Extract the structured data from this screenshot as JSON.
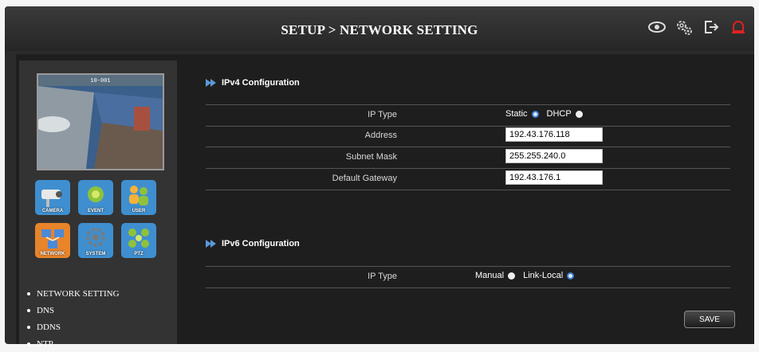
{
  "header": {
    "title": "SETUP > NETWORK SETTING",
    "icons": [
      "eye-icon",
      "settings-gear-icon",
      "logout-icon",
      "alarm-bell-icon"
    ],
    "alarm_color": "#e02020"
  },
  "sidebar": {
    "preview": {
      "timestamp": "10-001"
    },
    "modules": [
      {
        "label": "CAMERA",
        "icon": "camera-icon"
      },
      {
        "label": "EVENT",
        "icon": "event-icon"
      },
      {
        "label": "USER",
        "icon": "user-icon"
      },
      {
        "label": "NETWORK",
        "icon": "network-icon",
        "active": true
      },
      {
        "label": "SYSTEM",
        "icon": "system-icon"
      },
      {
        "label": "PTZ",
        "icon": "ptz-icon"
      }
    ],
    "nav_items": [
      "NETWORK SETTING",
      "DNS",
      "DDNS",
      "NTP"
    ]
  },
  "ipv4": {
    "title": "IPv4 Configuration",
    "ip_type": {
      "label": "IP Type",
      "options": [
        "Static",
        "DHCP"
      ],
      "selected": "Static"
    },
    "address": {
      "label": "Address",
      "value": "192.43.176.118"
    },
    "subnet": {
      "label": "Subnet Mask",
      "value": "255.255.240.0"
    },
    "gateway": {
      "label": "Default Gateway",
      "value": "192.43.176.1"
    }
  },
  "ipv6": {
    "title": "IPv6 Configuration",
    "ip_type": {
      "label": "IP Type",
      "options": [
        "Manual",
        "Link-Local"
      ],
      "selected": "Link-Local"
    }
  },
  "save_label": "SAVE"
}
